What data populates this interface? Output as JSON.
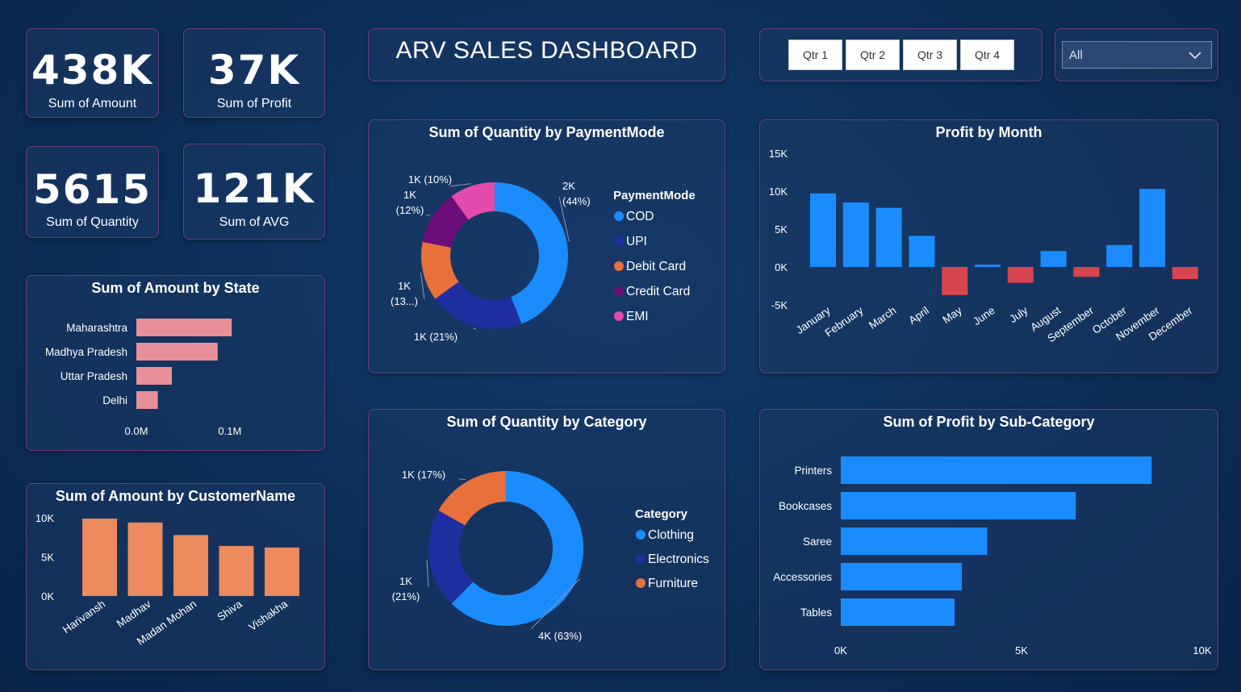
{
  "dashboard_title": "ARV SALES DASHBOARD",
  "kpis": [
    {
      "value": "438K",
      "label": "Sum of Amount"
    },
    {
      "value": "37K",
      "label": "Sum of Profit"
    },
    {
      "value": "5615",
      "label": "Sum of Quantity"
    },
    {
      "value": "121K",
      "label": "Sum of AVG"
    }
  ],
  "quarter_buttons": [
    "Qtr 1",
    "Qtr 2",
    "Qtr 3",
    "Qtr 4"
  ],
  "slicer": {
    "selected": "All"
  },
  "colors": {
    "blue": "#1a8cff",
    "navy": "#1f2fa0",
    "orange": "#e8703a",
    "purple": "#6d0f7a",
    "pink": "#e34aae",
    "negative_red": "#d64550",
    "salmon_bar": "#e8909a",
    "customer_bar": "#ec8b5e"
  },
  "chart_data": [
    {
      "id": "state",
      "type": "bar",
      "orientation": "horizontal",
      "title": "Sum of Amount by State",
      "categories": [
        "Maharashtra",
        "Madhya Pradesh",
        "Uttar Pradesh",
        "Delhi"
      ],
      "values": [
        0.102,
        0.087,
        0.038,
        0.023
      ],
      "unit": "M",
      "x_ticks": [
        "0.0M",
        "0.1M"
      ],
      "xlim": [
        0,
        0.12
      ]
    },
    {
      "id": "customer",
      "type": "bar",
      "title": "Sum of Amount by CustomerName",
      "categories": [
        "Harivansh",
        "Madhav",
        "Madan Mohan",
        "Shiva",
        "Vishakha"
      ],
      "values": [
        9900,
        9400,
        7800,
        6400,
        6200
      ],
      "y_ticks": [
        "10K",
        "5K",
        "0K"
      ],
      "ylim": [
        0,
        10000
      ]
    },
    {
      "id": "payment",
      "type": "pie",
      "donut": true,
      "title": "Sum of Quantity by PaymentMode",
      "legend_title": "PaymentMode",
      "slices": [
        {
          "name": "COD",
          "value": 44,
          "label": [
            "2K",
            "(44%)"
          ]
        },
        {
          "name": "UPI",
          "value": 21,
          "label": [
            "1K (21%)"
          ]
        },
        {
          "name": "Debit Card",
          "value": 13,
          "label": [
            "1K",
            "(13...)"
          ]
        },
        {
          "name": "Credit Card",
          "value": 12,
          "label": [
            "1K",
            "(12%)"
          ]
        },
        {
          "name": "EMI",
          "value": 10,
          "label": [
            "1K (10%)"
          ]
        }
      ]
    },
    {
      "id": "month",
      "type": "bar",
      "title": "Profit by Month",
      "categories": [
        "January",
        "February",
        "March",
        "April",
        "May",
        "June",
        "July",
        "August",
        "September",
        "October",
        "November",
        "December"
      ],
      "values": [
        9700,
        8500,
        7800,
        4100,
        -3700,
        300,
        -2100,
        2100,
        -1300,
        2900,
        10300,
        -1600
      ],
      "y_ticks": [
        "15K",
        "10K",
        "5K",
        "0K",
        "-5K"
      ],
      "ylim": [
        -5000,
        15000
      ]
    },
    {
      "id": "category",
      "type": "pie",
      "donut": true,
      "title": "Sum of Quantity by Category",
      "legend_title": "Category",
      "slices": [
        {
          "name": "Clothing",
          "value": 63,
          "label": [
            "4K (63%)"
          ]
        },
        {
          "name": "Electronics",
          "value": 21,
          "label": [
            "1K",
            "(21%)"
          ]
        },
        {
          "name": "Furniture",
          "value": 17,
          "label": [
            "1K (17%)"
          ]
        }
      ]
    },
    {
      "id": "subcategory",
      "type": "bar",
      "orientation": "horizontal",
      "title": "Sum of Profit by Sub-Category",
      "categories": [
        "Printers",
        "Bookcases",
        "Saree",
        "Accessories",
        "Tables"
      ],
      "values": [
        8600,
        6500,
        4050,
        3350,
        3150
      ],
      "x_ticks": [
        "0K",
        "5K",
        "10K"
      ],
      "xlim": [
        0,
        10000
      ]
    }
  ]
}
